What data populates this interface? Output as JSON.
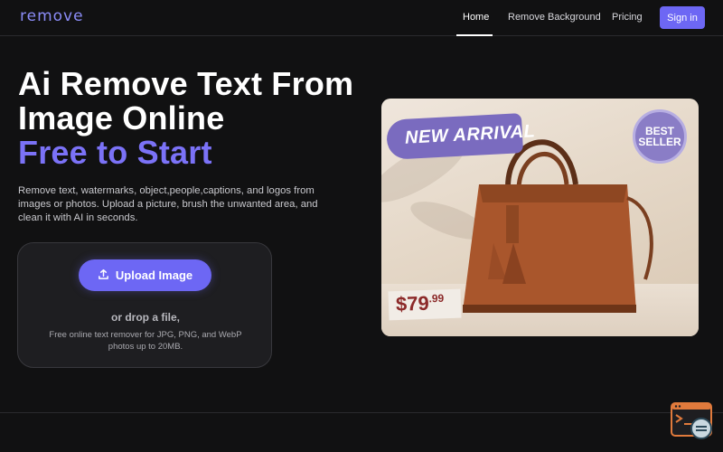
{
  "header": {
    "logo": "remove",
    "nav": {
      "home": "Home",
      "remove_background": "Remove Background",
      "pricing": "Pricing"
    },
    "signin_label": "Sign in"
  },
  "hero": {
    "title_line1": "Ai Remove Text From",
    "title_line2": "Image Online",
    "title_accent": "Free to Start",
    "description": "Remove text, watermarks, object,people,captions, and logos from images or photos. Upload a picture, brush the unwanted area, and clean it with AI in seconds."
  },
  "upload": {
    "button_label": "Upload Image",
    "drop_text": "or drop a file,",
    "hint": "Free online text remover for JPG, PNG, and WebP photos up to 20MB."
  },
  "product_image": {
    "badge_new": "NEW ARRIVAL",
    "badge_best_line1": "BEST",
    "badge_best_line2": "SELLER",
    "price_main": "$79",
    "price_cents": ".99"
  },
  "colors": {
    "accent": "#6d67f4",
    "background": "#111112"
  }
}
